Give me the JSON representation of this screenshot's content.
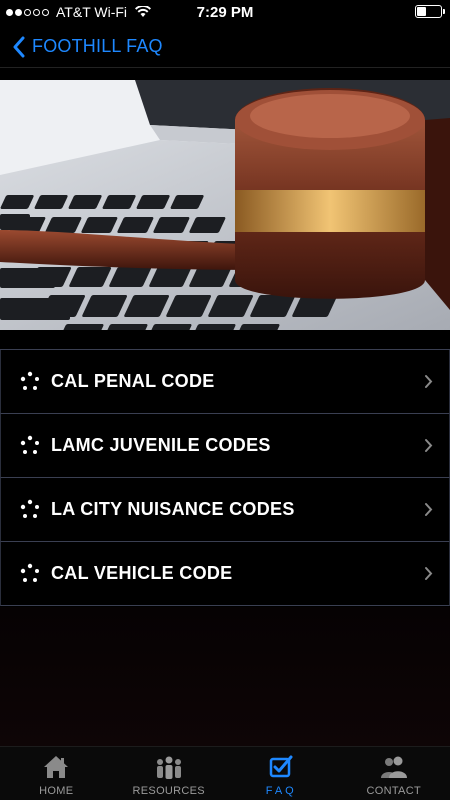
{
  "status_bar": {
    "carrier": "AT&T Wi-Fi",
    "time": "7:29 PM",
    "signal_bars_filled": 2,
    "signal_bars_total": 5,
    "battery_level": 0.4
  },
  "nav": {
    "back_icon": "chevron-left-icon",
    "title": "FOOTHILL FAQ"
  },
  "hero": {
    "image": "gavel-on-laptop-keyboard"
  },
  "list": {
    "items": [
      {
        "label": "CAL PENAL CODE",
        "icon": "dots-spinner-icon"
      },
      {
        "label": "LAMC JUVENILE CODES",
        "icon": "dots-spinner-icon"
      },
      {
        "label": "LA CITY NUISANCE CODES",
        "icon": "dots-spinner-icon"
      },
      {
        "label": "CAL VEHICLE CODE",
        "icon": "dots-spinner-icon"
      }
    ]
  },
  "tabs": [
    {
      "label": "HOME",
      "icon": "house-icon",
      "active": false
    },
    {
      "label": "RESOURCES",
      "icon": "people-group-icon",
      "active": false
    },
    {
      "label": "FAQ",
      "icon": "checkbox-check-icon",
      "active": true
    },
    {
      "label": "CONTACT",
      "icon": "contacts-icon",
      "active": false
    }
  ],
  "colors": {
    "accent": "#1e88ff",
    "background": "#000000",
    "divider": "#3a3f52",
    "inactive_tab": "#9a9a9a"
  }
}
